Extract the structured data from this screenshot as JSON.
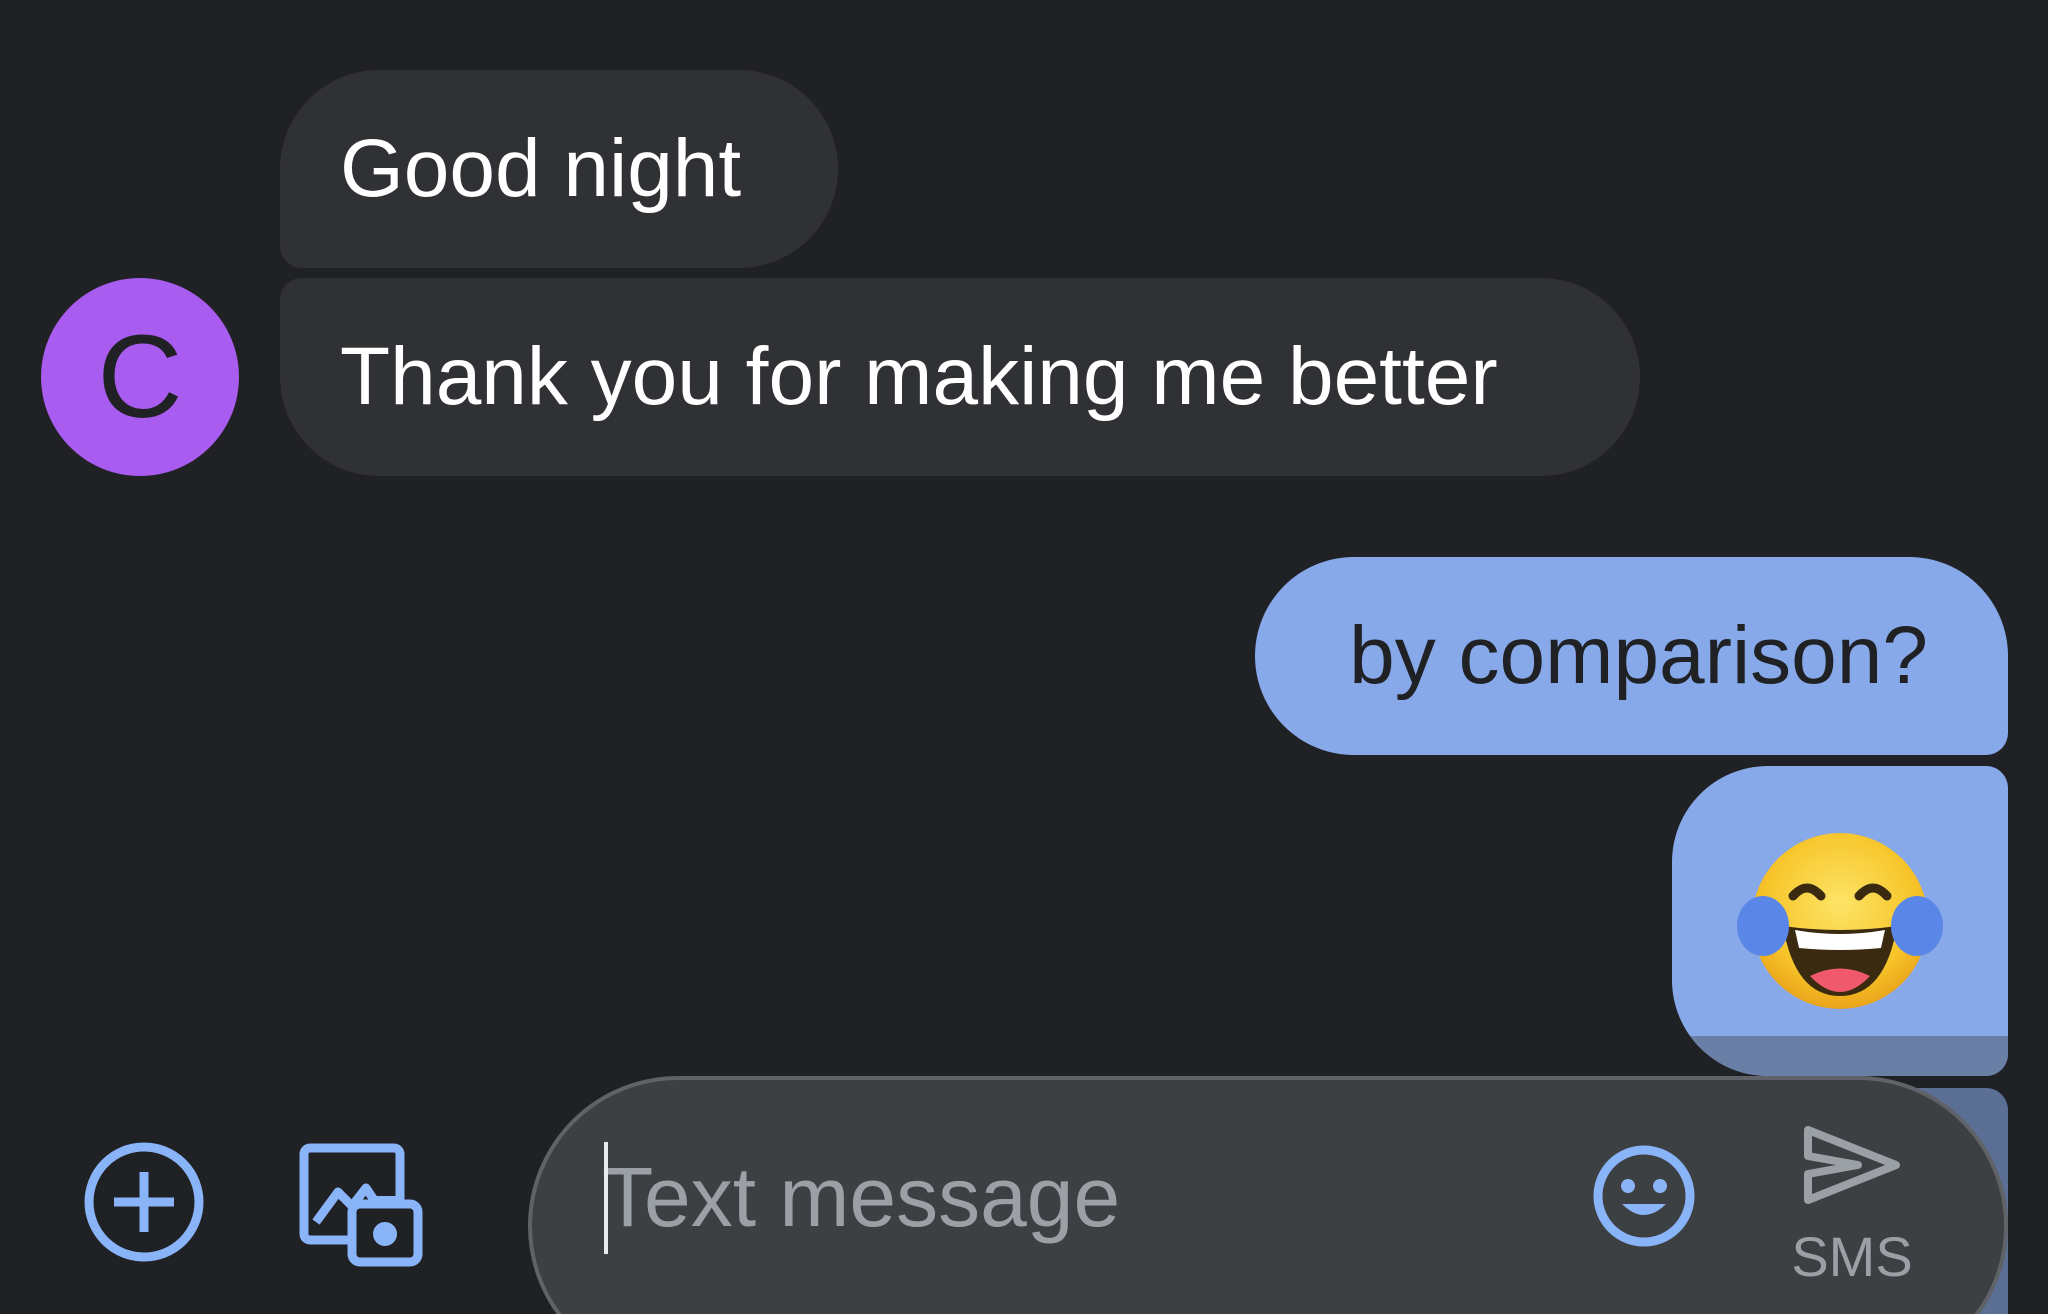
{
  "conversation": {
    "contact": {
      "avatar_initial": "C",
      "avatar_color": "#a95cf0"
    },
    "messages": [
      {
        "direction": "incoming",
        "text": "Good night"
      },
      {
        "direction": "incoming",
        "text": "Thank you for making me better"
      },
      {
        "direction": "outgoing",
        "text": "by comparison?"
      },
      {
        "direction": "outgoing",
        "text": "😂"
      }
    ]
  },
  "composer": {
    "placeholder": "Text message",
    "send_label": "SMS",
    "icons": [
      "add-icon",
      "gallery-camera-icon",
      "emoji-icon",
      "send-icon"
    ]
  },
  "colors": {
    "background": "#202124",
    "incoming_bubble": "#303134",
    "outgoing_bubble": "#87a9ea",
    "accent": "#8ab4f8"
  }
}
